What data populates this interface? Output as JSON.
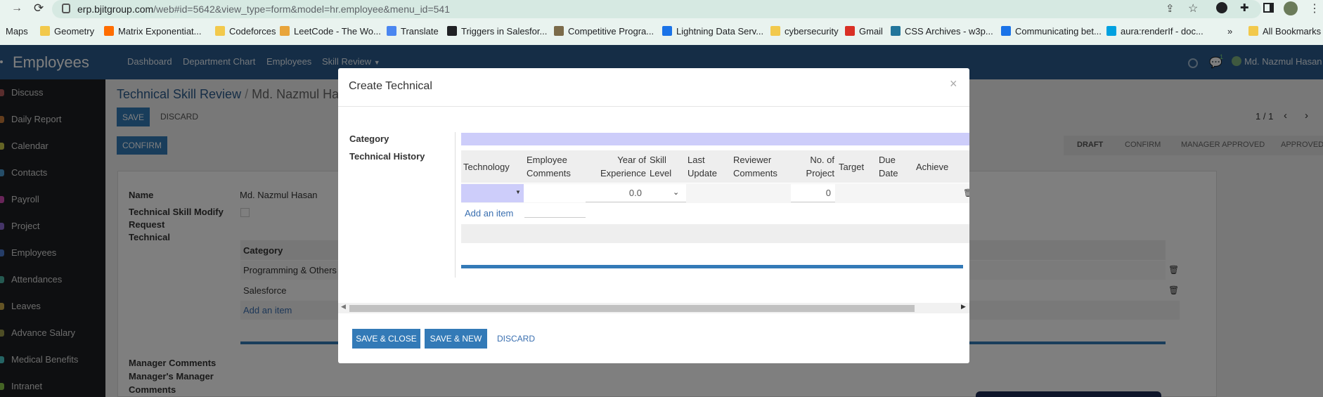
{
  "browser": {
    "url_host": "erp.bjitgroup.com",
    "url_rest": "/web#id=5642&view_type=form&model=hr.employee&menu_id=541",
    "bookmarks": [
      "Maps",
      "Geometry",
      "Matrix Exponentiat...",
      "Codeforces",
      "LeetCode - The Wo...",
      "Translate",
      "Triggers in Salesfor...",
      "Competitive Progra...",
      "Lightning Data Serv...",
      "cybersecurity",
      "Gmail",
      "CSS Archives - w3p...",
      "Communicating bet...",
      "aura:renderIf - doc..."
    ],
    "more": "»",
    "all_bookmarks": "All Bookmarks"
  },
  "app": {
    "title": "Employees",
    "menu": [
      "Dashboard",
      "Department Chart",
      "Employees",
      "Skill Review"
    ],
    "user": "Md. Nazmul Hasan",
    "chat_badge": "1"
  },
  "sidebar": [
    "Discuss",
    "Daily Report",
    "Calendar",
    "Contacts",
    "Payroll",
    "Project",
    "Employees",
    "Attendances",
    "Leaves",
    "Advance Salary",
    "Medical Benefits",
    "Intranet"
  ],
  "page": {
    "breadcrumb_parent": "Technical Skill Review",
    "breadcrumb_sep": "/",
    "breadcrumb_current": "Md. Nazmul Ha",
    "save": "SAVE",
    "discard": "DISCARD",
    "confirm": "CONFIRM",
    "pager": "1 / 1",
    "stages": [
      "DRAFT",
      "CONFIRM",
      "MANAGER APPROVED",
      "APPROVED"
    ],
    "name_label": "Name",
    "name_value": "Md. Nazmul Hasan",
    "modify_label_1": "Technical Skill Modify",
    "modify_label_2": "Request",
    "technical_label": "Technical",
    "table_header": "Category",
    "rows": [
      "Programming & Others",
      "Salesforce"
    ],
    "add_item": "Add an item",
    "manager_comments": "Manager Comments",
    "mm_comments_1": "Manager's Manager",
    "mm_comments_2": "Comments"
  },
  "modal": {
    "title": "Create Technical",
    "close": "×",
    "category_label": "Category",
    "history_label": "Technical History",
    "columns": [
      [
        "Technology",
        ""
      ],
      [
        "Employee",
        "Comments"
      ],
      [
        "Year of",
        "Experience"
      ],
      [
        "Skill",
        "Level"
      ],
      [
        "Last",
        "Update"
      ],
      [
        "Reviewer",
        "Comments"
      ],
      [
        "No. of",
        "Project"
      ],
      [
        "Target",
        ""
      ],
      [
        "Due",
        "Date"
      ],
      [
        "Achieve",
        ""
      ]
    ],
    "year_value": "0.0",
    "project_value": "0",
    "add_item": "Add an item",
    "save_close": "SAVE & CLOSE",
    "save_new": "SAVE & NEW",
    "discard": "DISCARD"
  },
  "colors": {
    "navbar": "#2a5b8c",
    "primary": "#337ab7",
    "sidebar": "#1d1f22",
    "highlight": "#cdcdfa"
  }
}
